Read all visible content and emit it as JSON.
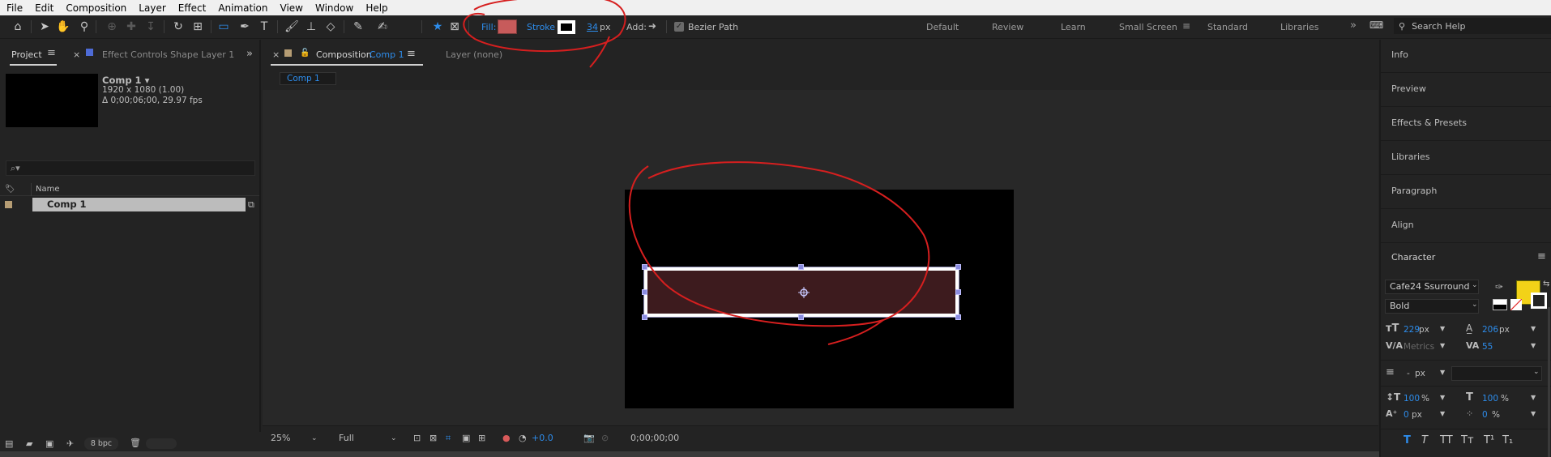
{
  "menu": [
    "File",
    "Edit",
    "Composition",
    "Layer",
    "Effect",
    "Animation",
    "View",
    "Window",
    "Help"
  ],
  "toolbar": {
    "fill_label": "Fill:",
    "stroke_label": "Stroke",
    "stroke_width": "34",
    "stroke_unit": "px",
    "add_label": "Add:",
    "bezier_label": "Bezier Path",
    "fill_color": "#c75b5b"
  },
  "workspaces": [
    "Default",
    "Review",
    "Learn",
    "Small Screen",
    "Standard",
    "Libraries"
  ],
  "active_workspace": "Small Screen",
  "search_help": "Search Help",
  "left_panel": {
    "tab_project": "Project",
    "tab_effect_controls": "Effect Controls Shape Layer 1",
    "comp_name": "Comp 1 ▾",
    "comp_size": "1920 x 1080 (1.00)",
    "comp_duration": "Δ 0;00;06;00, 29.97 fps",
    "search_placeholder": "⌕▾",
    "col_name": "Name",
    "items": [
      "Comp 1"
    ],
    "bpc": "8 bpc"
  },
  "composition": {
    "tab_prefix": "Composition",
    "tab_name": "Comp 1",
    "layer_tab": "Layer  (none)",
    "breadcrumb": "Comp 1",
    "zoom": "25%",
    "resolution": "Full",
    "exposure": "+0.0",
    "timecode": "0;00;00;00"
  },
  "right_panel": {
    "sections": [
      "Info",
      "Preview",
      "Effects & Presets",
      "Libraries",
      "Paragraph",
      "Align"
    ],
    "character_title": "Character",
    "font_family": "Cafe24 Ssurround",
    "font_style": "Bold",
    "font_size": "229",
    "leading": "206",
    "kerning": "Metrics",
    "tracking": "55",
    "stroke_width_label": "-",
    "stroke_unit": "px",
    "vertical_scale": "100",
    "horizontal_scale": "100",
    "baseline_shift": "0",
    "tsume": "0",
    "px": "px",
    "pct": "%",
    "fill_color": "#f2d218",
    "format_buttons": [
      "T",
      "T",
      "TT",
      "Tт",
      "T¹",
      "T₁"
    ]
  }
}
